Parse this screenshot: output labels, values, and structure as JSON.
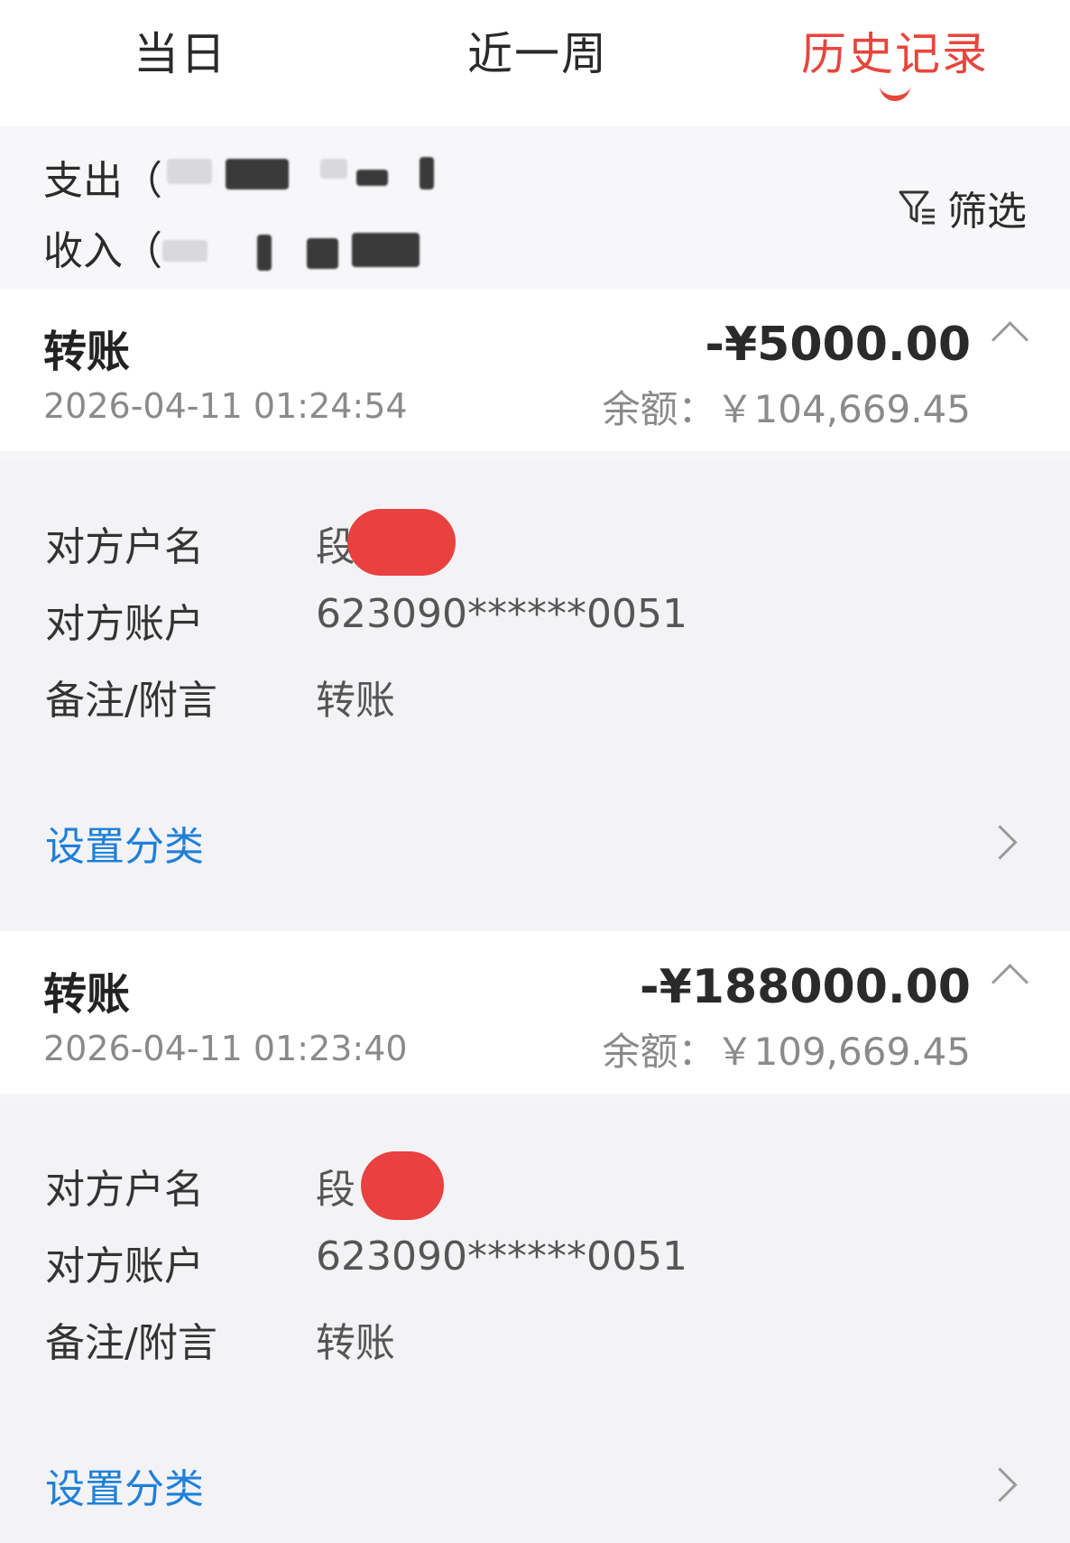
{
  "tabs": [
    {
      "label": "当日",
      "active": false
    },
    {
      "label": "近一周",
      "active": false
    },
    {
      "label": "历史记录",
      "active": true
    }
  ],
  "summary": {
    "expense_label": "支出（",
    "income_label": "收入（",
    "filter_label": "筛选"
  },
  "records": [
    {
      "title": "转账",
      "time": "2026-04-11 01:24:54",
      "amount": "-¥5000.00",
      "balance": "余额：￥104,669.45",
      "details": {
        "name_label": "对方户名",
        "name_value": "段",
        "account_label": "对方账户",
        "account_value": "623090******0051",
        "note_label": "备注/附言",
        "note_value": "转账"
      },
      "category_link": "设置分类"
    },
    {
      "title": "转账",
      "time": "2026-04-11 01:23:40",
      "amount": "-¥188000.00",
      "balance": "余额：￥109,669.45",
      "details": {
        "name_label": "对方户名",
        "name_value": "段",
        "account_label": "对方账户",
        "account_value": "623090******0051",
        "note_label": "备注/附言",
        "note_value": "转账"
      },
      "category_link": "设置分类"
    }
  ],
  "colors": {
    "accent": "#e8453c",
    "link": "#1f80d8",
    "mask": "#e94040"
  }
}
